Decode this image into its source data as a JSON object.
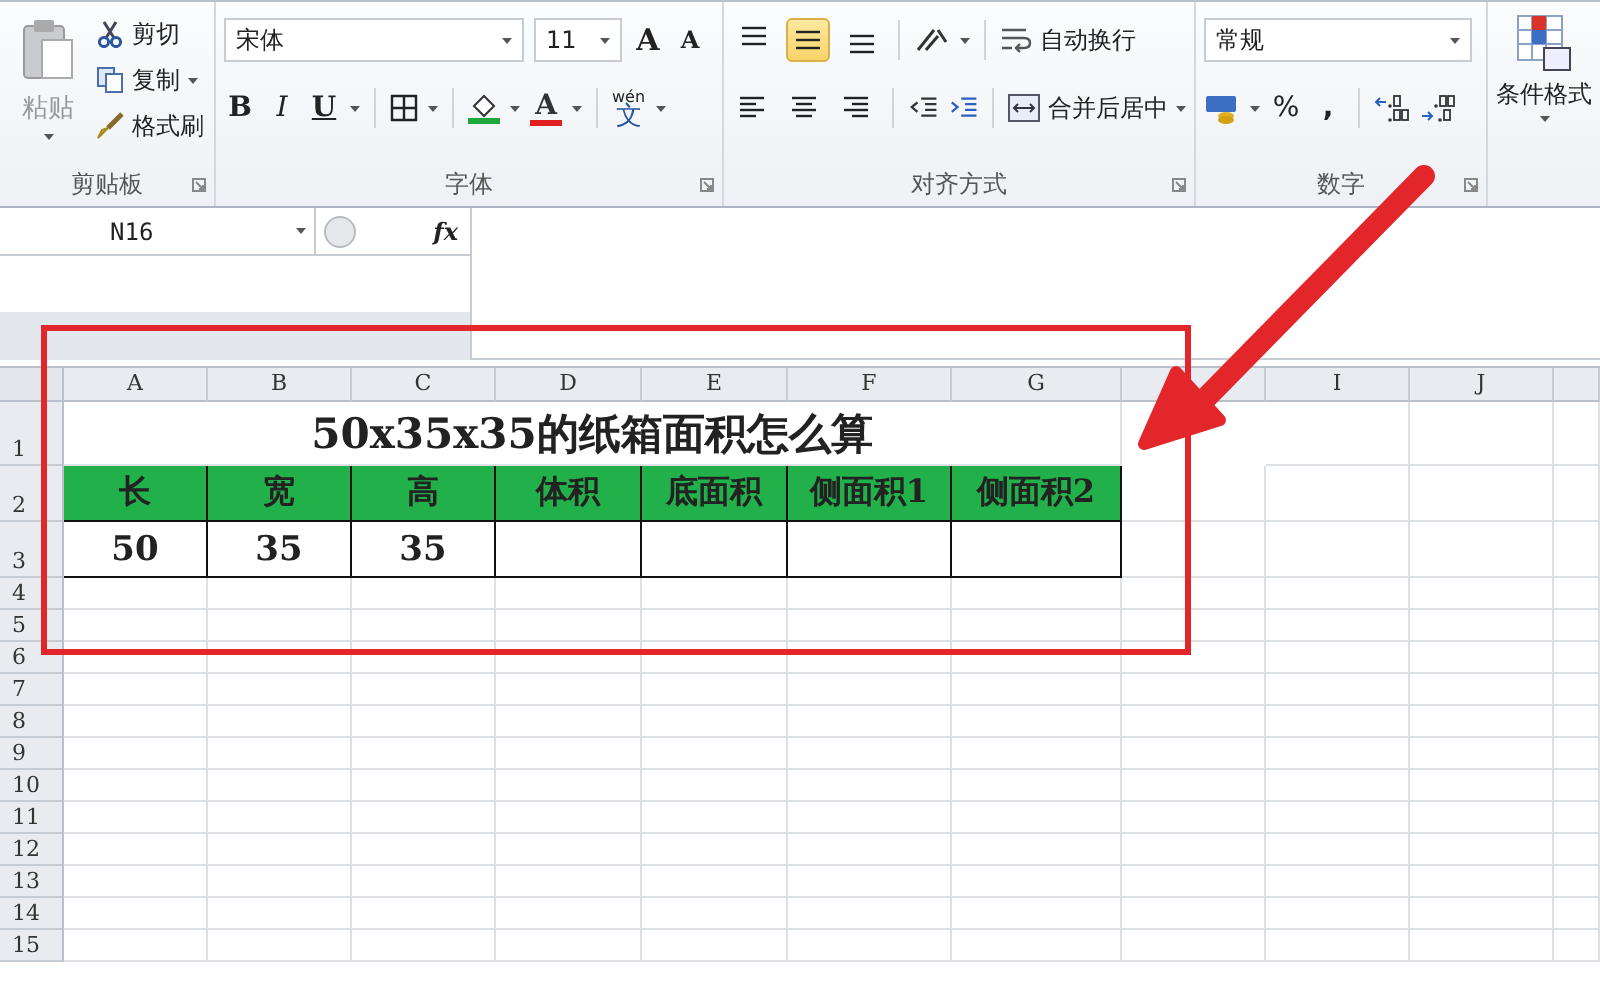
{
  "ribbon": {
    "clipboard": {
      "paste": "粘贴",
      "cut": "剪切",
      "copy": "复制",
      "format_painter": "格式刷",
      "label": "剪贴板"
    },
    "font": {
      "font_name": "宋体",
      "font_size": "11",
      "grow": "A",
      "shrink": "A",
      "bold": "B",
      "italic": "I",
      "underline": "U",
      "font_color": "A",
      "phonetic": "wén",
      "phonetic_char": "文",
      "label": "字体"
    },
    "alignment": {
      "vertical": [
        {
          "kind": "top",
          "selected": false
        },
        {
          "kind": "middle",
          "selected": true
        },
        {
          "kind": "bottom",
          "selected": false
        }
      ],
      "horizontal": [
        {
          "kind": "left",
          "selected": false
        },
        {
          "kind": "center",
          "selected": false
        },
        {
          "kind": "right",
          "selected": false
        }
      ],
      "wrap_text": "自动换行",
      "merge_center": "合并后居中",
      "label": "对齐方式"
    },
    "number": {
      "format": "常规",
      "percent": "%",
      "comma": ",",
      "label": "数字"
    },
    "styles": {
      "conditional_format": "条件格式"
    }
  },
  "formula_bar": {
    "name_box": "N16",
    "fx": "fx"
  },
  "sheet": {
    "columns_left": [
      "A",
      "B",
      "C",
      "D",
      "E",
      "F",
      "G"
    ],
    "columns_right": [
      "I",
      "J"
    ],
    "rows": [
      {
        "number": "1",
        "kind": "title",
        "title": "50x35x35的纸箱面积怎么算"
      },
      {
        "number": "2",
        "kind": "header",
        "cells": [
          "长",
          "宽",
          "高",
          "体积",
          "底面积",
          "侧面积1",
          "侧面积2"
        ]
      },
      {
        "number": "3",
        "kind": "data",
        "cells": [
          "50",
          "35",
          "35"
        ]
      },
      {
        "number": "4",
        "kind": "empty"
      },
      {
        "number": "5",
        "kind": "empty"
      },
      {
        "number": "6",
        "kind": "empty"
      },
      {
        "number": "7",
        "kind": "empty"
      },
      {
        "number": "8",
        "kind": "empty"
      },
      {
        "number": "9",
        "kind": "empty"
      },
      {
        "number": "10",
        "kind": "empty"
      },
      {
        "number": "11",
        "kind": "empty"
      },
      {
        "number": "12",
        "kind": "empty"
      },
      {
        "number": "13",
        "kind": "empty"
      },
      {
        "number": "14",
        "kind": "empty"
      },
      {
        "number": "15",
        "kind": "empty"
      }
    ]
  }
}
